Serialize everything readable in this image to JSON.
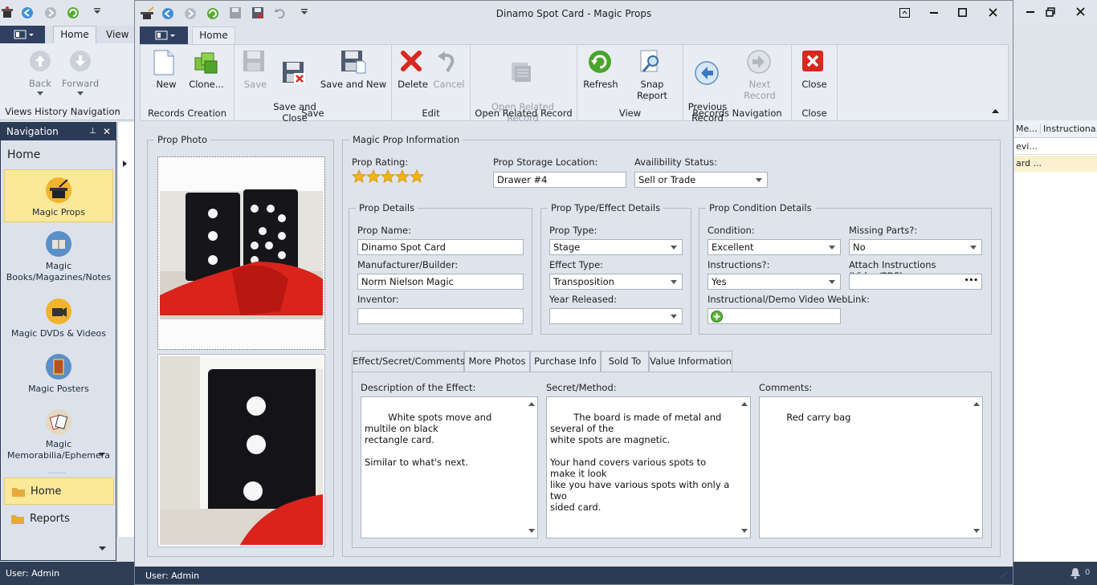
{
  "back_window": {
    "tabs": {
      "home": "Home",
      "view": "View"
    },
    "ribbon": {
      "back": "Back",
      "forward": "Forward",
      "group": "Views History Navigation"
    },
    "navigation": {
      "title": "Navigation",
      "home_label": "Home",
      "items": [
        {
          "label": "Magic Props",
          "icon": "magic-hat-icon"
        },
        {
          "label": "Magic\nBooks/Magazines/Notes",
          "icon": "books-icon"
        },
        {
          "label": "Magic DVDs & Videos",
          "icon": "video-camera-icon"
        },
        {
          "label": "Magic Posters",
          "icon": "poster-icon"
        },
        {
          "label": "Magic\nMemorabilia/Ephemera",
          "icon": "cards-icon"
        }
      ],
      "groups": [
        {
          "label": "Home"
        },
        {
          "label": "Reports"
        }
      ]
    },
    "grid": {
      "col1": "Me...",
      "col2": "Instructiona...",
      "row1": "evi...",
      "row2": "ard ..."
    },
    "status": "User: Admin"
  },
  "window": {
    "title": "Dinamo Spot Card - Magic Props",
    "tab_home": "Home",
    "status": "User: Admin"
  },
  "ribbon": {
    "groups": [
      {
        "label": "Records Creation",
        "buttons": [
          "New",
          "Clone..."
        ]
      },
      {
        "label": "Save",
        "buttons": [
          "Save",
          "Save and\nClose",
          "Save and New"
        ]
      },
      {
        "label": "Edit",
        "buttons": [
          "Delete",
          "Cancel"
        ]
      },
      {
        "label": "Open Related Record",
        "buttons": [
          "Open Related\nRecord"
        ]
      },
      {
        "label": "View",
        "buttons": [
          "Refresh",
          "Snap Report"
        ]
      },
      {
        "label": "Records Navigation",
        "buttons": [
          "Previous\nRecord",
          "Next Record"
        ]
      },
      {
        "label": "Close",
        "buttons": [
          "Close"
        ]
      }
    ]
  },
  "photo_panel": {
    "title": "Prop Photo"
  },
  "info": {
    "title": "Magic Prop Information",
    "rating_label": "Prop Rating:",
    "rating_value": 5,
    "storage_label": "Prop Storage Location:",
    "storage_value": "Drawer #4",
    "availability_label": "Availibility Status:",
    "availability_value": "Sell or Trade"
  },
  "details": {
    "title": "Prop Details",
    "name_label": "Prop Name:",
    "name_value": "Dinamo Spot Card",
    "builder_label": "Manufacturer/Builder:",
    "builder_value": "Norm Nielson Magic",
    "inventor_label": "Inventor:",
    "inventor_value": ""
  },
  "type_details": {
    "title": "Prop Type/Effect Details",
    "type_label": "Prop Type:",
    "type_value": "Stage",
    "effect_label": "Effect Type:",
    "effect_value": "Transposition",
    "year_label": "Year Released:",
    "year_value": ""
  },
  "condition": {
    "title": "Prop Condition Details",
    "condition_label": "Condition:",
    "condition_value": "Excellent",
    "missing_label": "Missing Parts?:",
    "missing_value": "No",
    "instructions_label": "Instructions?:",
    "instructions_value": "Yes",
    "attach_label": "Attach Instructions (Video/PDF):",
    "attach_button": "•••",
    "weblink_label": "Instructional/Demo Video WebLink:"
  },
  "tabs": [
    "Effect/Secret/Comments",
    "More Photos",
    "Purchase Info",
    "Sold To",
    "Value Information"
  ],
  "effect_tab": {
    "description_label": "Description of the Effect:",
    "description_value": "White spots move and multile on black\nrectangle card.\n\nSimilar to what's next.",
    "secret_label": "Secret/Method:",
    "secret_value": "The board is made of metal and several of the\nwhite spots are magnetic.\n\nYour hand covers various spots to make it look\nlike you have various spots with only a two\nsided card.",
    "comments_label": "Comments:",
    "comments_value": "Red carry bag"
  },
  "colors": {
    "accent": "#2c3b55",
    "nav_selected": "#fbe99a",
    "star": "#f3b21c",
    "delete_red": "#d9281e",
    "refresh_green": "#4aa52b"
  }
}
